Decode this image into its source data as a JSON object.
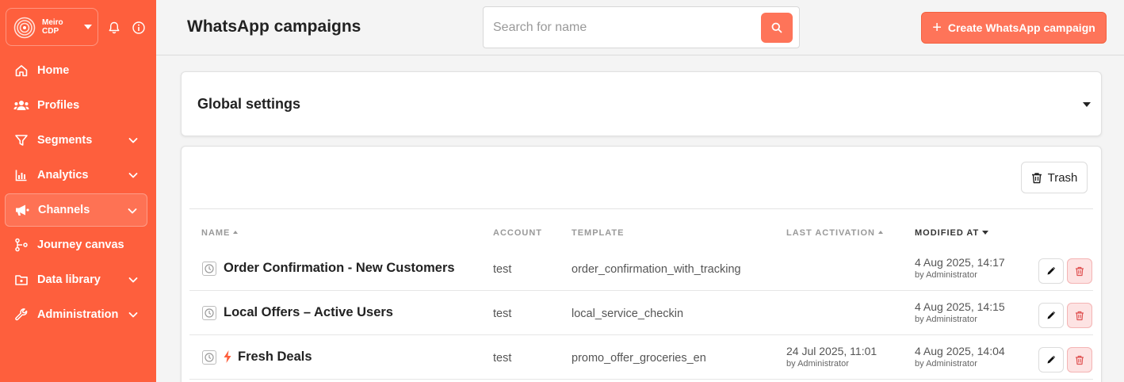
{
  "brand": {
    "name_line1": "Meiro",
    "name_line2": "CDP"
  },
  "sidebar": {
    "items": [
      {
        "label": "Home",
        "icon": "home-icon",
        "expandable": false
      },
      {
        "label": "Profiles",
        "icon": "users-icon",
        "expandable": false
      },
      {
        "label": "Segments",
        "icon": "filter-icon",
        "expandable": true
      },
      {
        "label": "Analytics",
        "icon": "bar-chart-icon",
        "expandable": true
      },
      {
        "label": "Channels",
        "icon": "megaphone-icon",
        "expandable": true,
        "active": true
      },
      {
        "label": "Journey canvas",
        "icon": "journey-icon",
        "expandable": false
      },
      {
        "label": "Data library",
        "icon": "folder-icon",
        "expandable": true
      },
      {
        "label": "Administration",
        "icon": "wrench-icon",
        "expandable": true
      }
    ]
  },
  "header": {
    "title": "WhatsApp campaigns",
    "search_placeholder": "Search for name",
    "search_value": "",
    "create_label": "Create WhatsApp campaign"
  },
  "global_settings": {
    "title": "Global settings"
  },
  "list": {
    "trash_label": "Trash",
    "columns": {
      "name": "NAME",
      "account": "ACCOUNT",
      "template": "TEMPLATE",
      "last_activation": "LAST ACTIVATION",
      "modified_at": "MODIFIED AT"
    },
    "rows": [
      {
        "name": "Order Confirmation - New Customers",
        "account": "test",
        "template": "order_confirmation_with_tracking",
        "last_activation": "",
        "last_activation_by": "",
        "modified_at": "4 Aug 2025, 14:17",
        "modified_by": "by Administrator",
        "active": false
      },
      {
        "name": "Local Offers – Active Users",
        "account": "test",
        "template": "local_service_checkin",
        "last_activation": "",
        "last_activation_by": "",
        "modified_at": "4 Aug 2025, 14:15",
        "modified_by": "by Administrator",
        "active": false
      },
      {
        "name": "Fresh Deals",
        "account": "test",
        "template": "promo_offer_groceries_en",
        "last_activation": "24 Jul 2025, 11:01",
        "last_activation_by": "by Administrator",
        "modified_at": "4 Aug 2025, 14:04",
        "modified_by": "by Administrator",
        "active": true
      }
    ]
  },
  "colors": {
    "brand": "#fe5f3d",
    "accent": "#fe7459",
    "delete_bg": "#fde3e3"
  }
}
